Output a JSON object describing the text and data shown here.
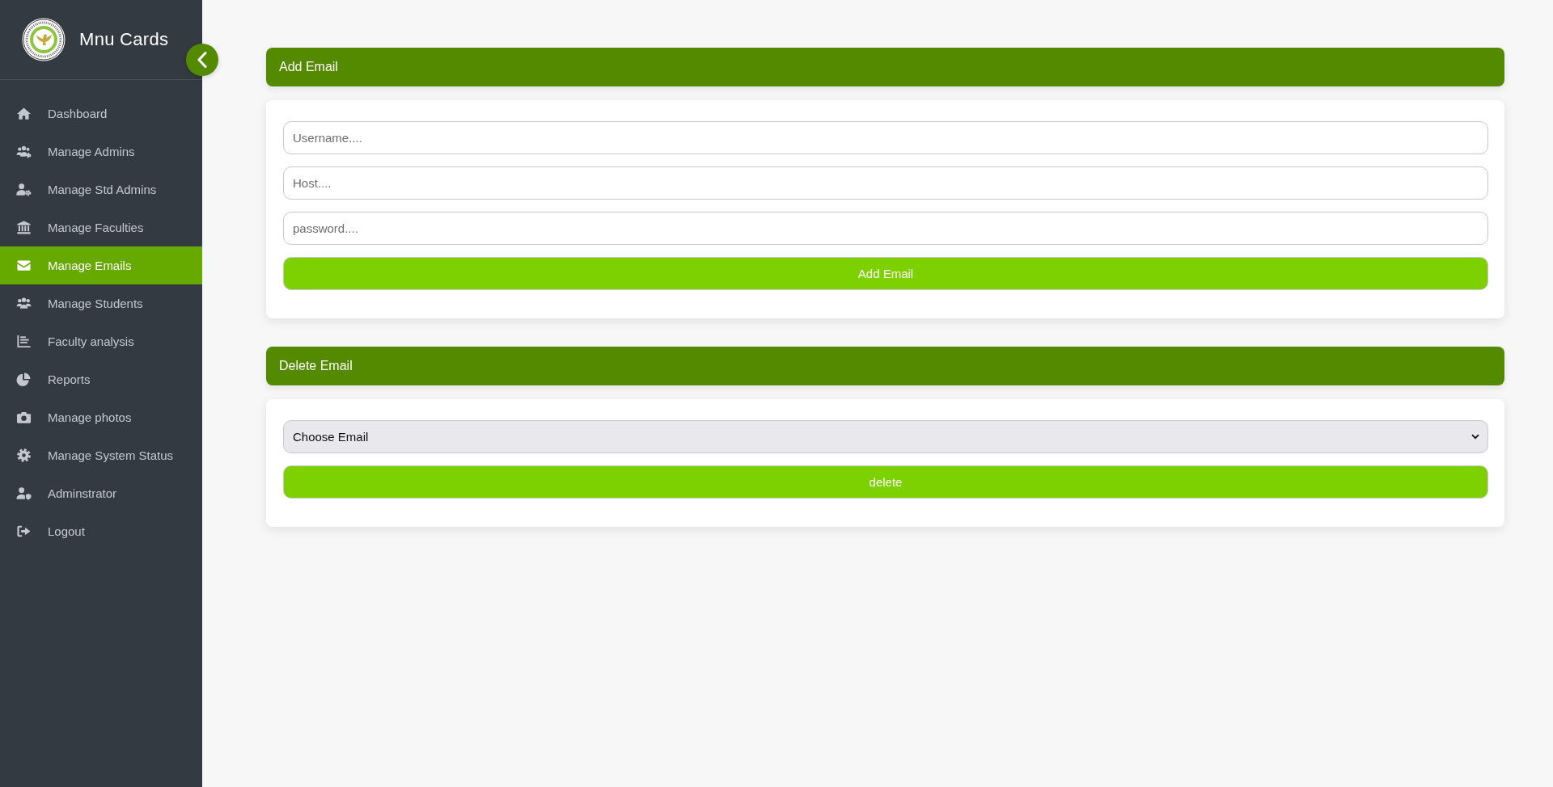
{
  "sidebar": {
    "brand": "Mnu Cards",
    "items": [
      {
        "label": "Dashboard",
        "kind": "home",
        "selected": false
      },
      {
        "label": "Manage Admins",
        "kind": "usersgear",
        "selected": false
      },
      {
        "label": "Manage Std Admins",
        "kind": "usergear",
        "selected": false
      },
      {
        "label": "Manage Faculties",
        "kind": "bank",
        "selected": false
      },
      {
        "label": "Manage Emails",
        "kind": "envelope",
        "selected": true
      },
      {
        "label": "Manage Students",
        "kind": "users",
        "selected": false
      },
      {
        "label": "Faculty analysis",
        "kind": "barchart",
        "selected": false
      },
      {
        "label": "Reports",
        "kind": "pie",
        "selected": false
      },
      {
        "label": "Manage photos",
        "kind": "camera",
        "selected": false
      },
      {
        "label": "Manage System Status",
        "kind": "gear",
        "selected": false
      },
      {
        "label": "Adminstrator",
        "kind": "usershield",
        "selected": false
      },
      {
        "label": "Logout",
        "kind": "logout",
        "selected": false
      }
    ]
  },
  "sections": [
    {
      "title": "Add Email",
      "fields": [
        {
          "kind": "input",
          "placeholder": "Username...."
        },
        {
          "kind": "input",
          "placeholder": "Host...."
        },
        {
          "kind": "input",
          "placeholder": "password...."
        }
      ],
      "button": "Add Email"
    },
    {
      "title": "Delete Email",
      "fields": [
        {
          "kind": "select",
          "value": "Choose Email"
        }
      ],
      "button": "delete"
    }
  ]
}
